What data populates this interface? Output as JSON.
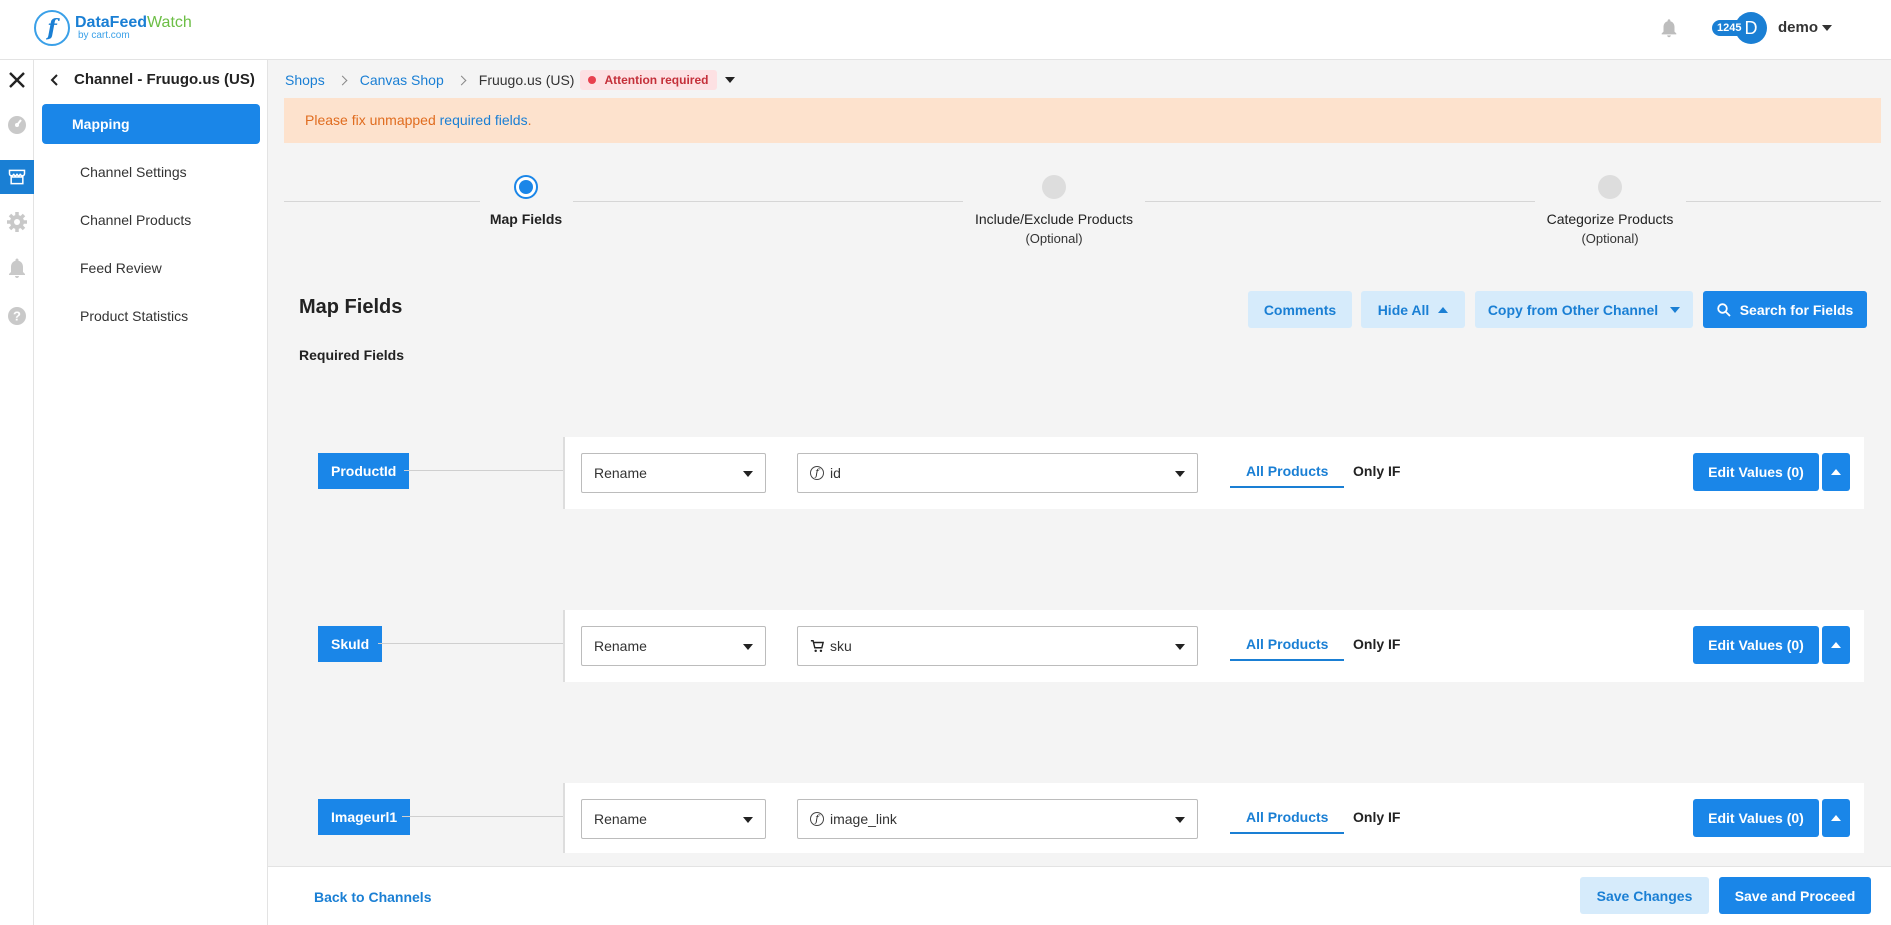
{
  "brand": {
    "name_part1": "DataFeed",
    "name_part2": "Watch",
    "tagline": "by cart.com"
  },
  "header": {
    "notification_count": "1245",
    "avatar_initial": "D",
    "user_name": "demo"
  },
  "sidebar": {
    "title": "Channel - Fruugo.us (US)",
    "items": [
      {
        "label": "Mapping",
        "active": true
      },
      {
        "label": "Channel Settings",
        "active": false
      },
      {
        "label": "Channel Products",
        "active": false
      },
      {
        "label": "Feed Review",
        "active": false
      },
      {
        "label": "Product Statistics",
        "active": false
      }
    ]
  },
  "breadcrumb": {
    "shops": "Shops",
    "shop": "Canvas Shop",
    "channel": "Fruugo.us (US)",
    "status": "Attention required"
  },
  "alert": {
    "text_before": "Please fix unmapped ",
    "link": "required fields",
    "text_after": "."
  },
  "steps": [
    {
      "label": "Map Fields",
      "sub": "",
      "active": true
    },
    {
      "label": "Include/Exclude Products",
      "sub": "(Optional)",
      "active": false
    },
    {
      "label": "Categorize Products",
      "sub": "(Optional)",
      "active": false
    }
  ],
  "section": {
    "title": "Map Fields",
    "subtitle": "Required Fields"
  },
  "toolbar": {
    "comments": "Comments",
    "hide_all": "Hide All",
    "copy": "Copy from Other Channel",
    "search": "Search for Fields"
  },
  "fields": [
    {
      "name": "ProductId",
      "action": "Rename",
      "source_icon": "function-icon",
      "source": "id",
      "tab_all": "All Products",
      "tab_if": "Only IF",
      "edit": "Edit Values (0)"
    },
    {
      "name": "SkuId",
      "action": "Rename",
      "source_icon": "cart-icon",
      "source": "sku",
      "tab_all": "All Products",
      "tab_if": "Only IF",
      "edit": "Edit Values (0)"
    },
    {
      "name": "Imageurl1",
      "action": "Rename",
      "source_icon": "function-icon",
      "source": "image_link",
      "tab_all": "All Products",
      "tab_if": "Only IF",
      "edit": "Edit Values (0)"
    }
  ],
  "footer": {
    "back": "Back to Channels",
    "save": "Save Changes",
    "proceed": "Save and Proceed"
  },
  "colors": {
    "primary": "#1a86e8",
    "light_button": "#d6ebfb",
    "alert_bg": "#fde2cd",
    "alert_text": "#e06c1f",
    "attention_bg": "#fde1e3",
    "attention_text": "#c4303a"
  }
}
